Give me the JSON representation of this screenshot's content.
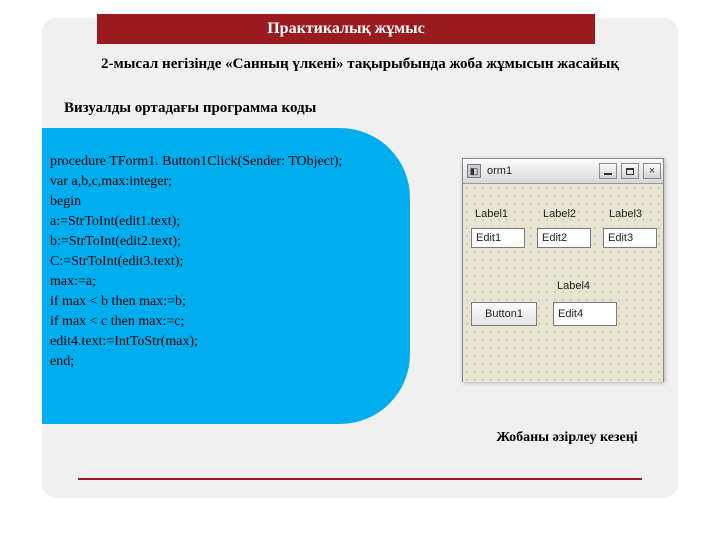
{
  "title": "Практикалық жұмыс",
  "subtitle": "2-мысал негізінде «Санның үлкені» тақырыбында жоба жұмысын жасайық",
  "code_heading": "Визуалды ортадағы программа коды",
  "code": "procedure TForm1. Button1Click(Sender: TObject);\nvar a,b,c,max:integer;\nbegin\na:=StrToInt(edit1.text);\nb:=StrToInt(edit2.text);\nC:=StrToInt(edit3.text);\nmax:=a;\nif max < b then max:=b;\nif max < c then max:=c;\nedit4.text:=IntToStr(max);\nend;",
  "form": {
    "title": "orm1",
    "label1": "Label1",
    "label2": "Label2",
    "label3": "Label3",
    "label4": "Label4",
    "edit1": "Edit1",
    "edit2": "Edit2",
    "edit3": "Edit3",
    "edit4": "Edit4",
    "button1": "Button1",
    "close": "×"
  },
  "caption": "Жобаны әзірлеу кезеңі",
  "colors": {
    "accent": "#9a1b1f",
    "code_bg": "#00aeef"
  }
}
